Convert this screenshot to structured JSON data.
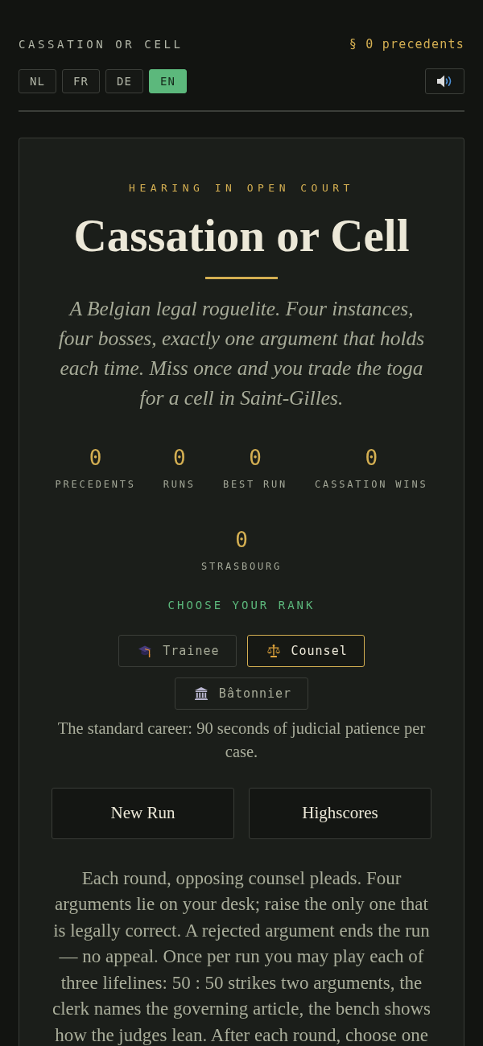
{
  "header": {
    "title": "CASSATION OR CELL",
    "precedents": "§ 0 precedents"
  },
  "languages": [
    {
      "label": "NL",
      "selected": false
    },
    {
      "label": "FR",
      "selected": false
    },
    {
      "label": "DE",
      "selected": false
    },
    {
      "label": "EN",
      "selected": true
    }
  ],
  "sound": {
    "muted": false
  },
  "hero": {
    "eyebrow": "HEARING IN OPEN COURT",
    "title": "Cassation or Cell",
    "tagline": "A Belgian legal roguelite. Four instances, four bosses, exactly one argument that holds each time. Miss once and you trade the toga for a cell in Saint-Gilles."
  },
  "stats": [
    {
      "value": "0",
      "label": "PRECEDENTS"
    },
    {
      "value": "0",
      "label": "RUNS"
    },
    {
      "value": "0",
      "label": "BEST RUN"
    },
    {
      "value": "0",
      "label": "CASSATION WINS"
    },
    {
      "value": "0",
      "label": "STRASBOURG"
    }
  ],
  "rank": {
    "heading": "CHOOSE YOUR RANK",
    "options": [
      {
        "label": "Trainee",
        "selected": false
      },
      {
        "label": "Counsel",
        "selected": true
      },
      {
        "label": "Bâtonnier",
        "selected": false
      }
    ],
    "description": "The standard career: 90 seconds of judicial patience per case."
  },
  "actions": [
    "New Run",
    "Highscores"
  ],
  "rules": "Each round, opposing counsel pleads. Four arguments lie on your desk; raise the only one that is legally correct. A rejected argument ends the run — no appeal. Once per run you may play each of three lifelines: 50 : 50 strikes two arguments, the clerk names the governing article, the bench shows how the judges lean. After each round, choose one"
}
